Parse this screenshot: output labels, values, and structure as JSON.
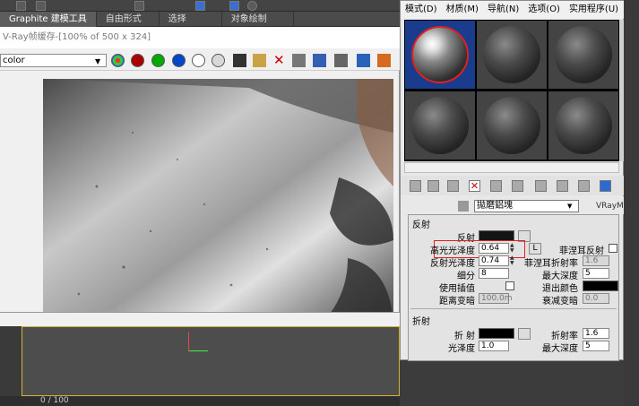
{
  "ribbon": {
    "tabs": [
      "Graphite 建模工具",
      "自由形式",
      "选择",
      "对象绘制"
    ]
  },
  "vfb": {
    "title": "V-Ray帧缓存-[100% of 500 x 324]",
    "channel": "color"
  },
  "timeline": {
    "frame": "0 / 100"
  },
  "mat_editor": {
    "menu": [
      "模式(D)",
      "材质(M)",
      "导航(N)",
      "选项(O)",
      "实用程序(U)"
    ],
    "material_name": "拋磨鋁塊",
    "material_type": "VRayMtl",
    "reflection": {
      "section": "反射",
      "reflect_label": "反射",
      "hilight_gloss_label": "高光光泽度",
      "hilight_gloss_value": "0.64",
      "lock_label": "L",
      "fresnel_label": "菲涅耳反射",
      "refl_gloss_label": "反射光泽度",
      "refl_gloss_value": "0.74",
      "fresnel_ior_label": "菲涅耳折射率",
      "fresnel_ior_value": "1.6",
      "subdivs_label": "细分",
      "subdivs_value": "8",
      "max_depth_label": "最大深度",
      "max_depth_value": "5",
      "use_interp_label": "使用插值",
      "exit_color_label": "退出颜色",
      "dim_distance_label": "距离变暗",
      "dim_distance_value": "100.0m",
      "dim_falloff_label": "衰减变暗",
      "dim_falloff_value": "0.0"
    },
    "refraction": {
      "section": "折射",
      "refract_label": "折 射",
      "ior_label": "折射率",
      "ior_value": "1.6",
      "gloss_label": "光泽度",
      "gloss_value": "1.0",
      "max_depth_label": "最大深度",
      "max_depth_value": "5"
    }
  },
  "colors": {
    "highlight_box": "#e02020",
    "viewport_border": "#d4b23a"
  }
}
